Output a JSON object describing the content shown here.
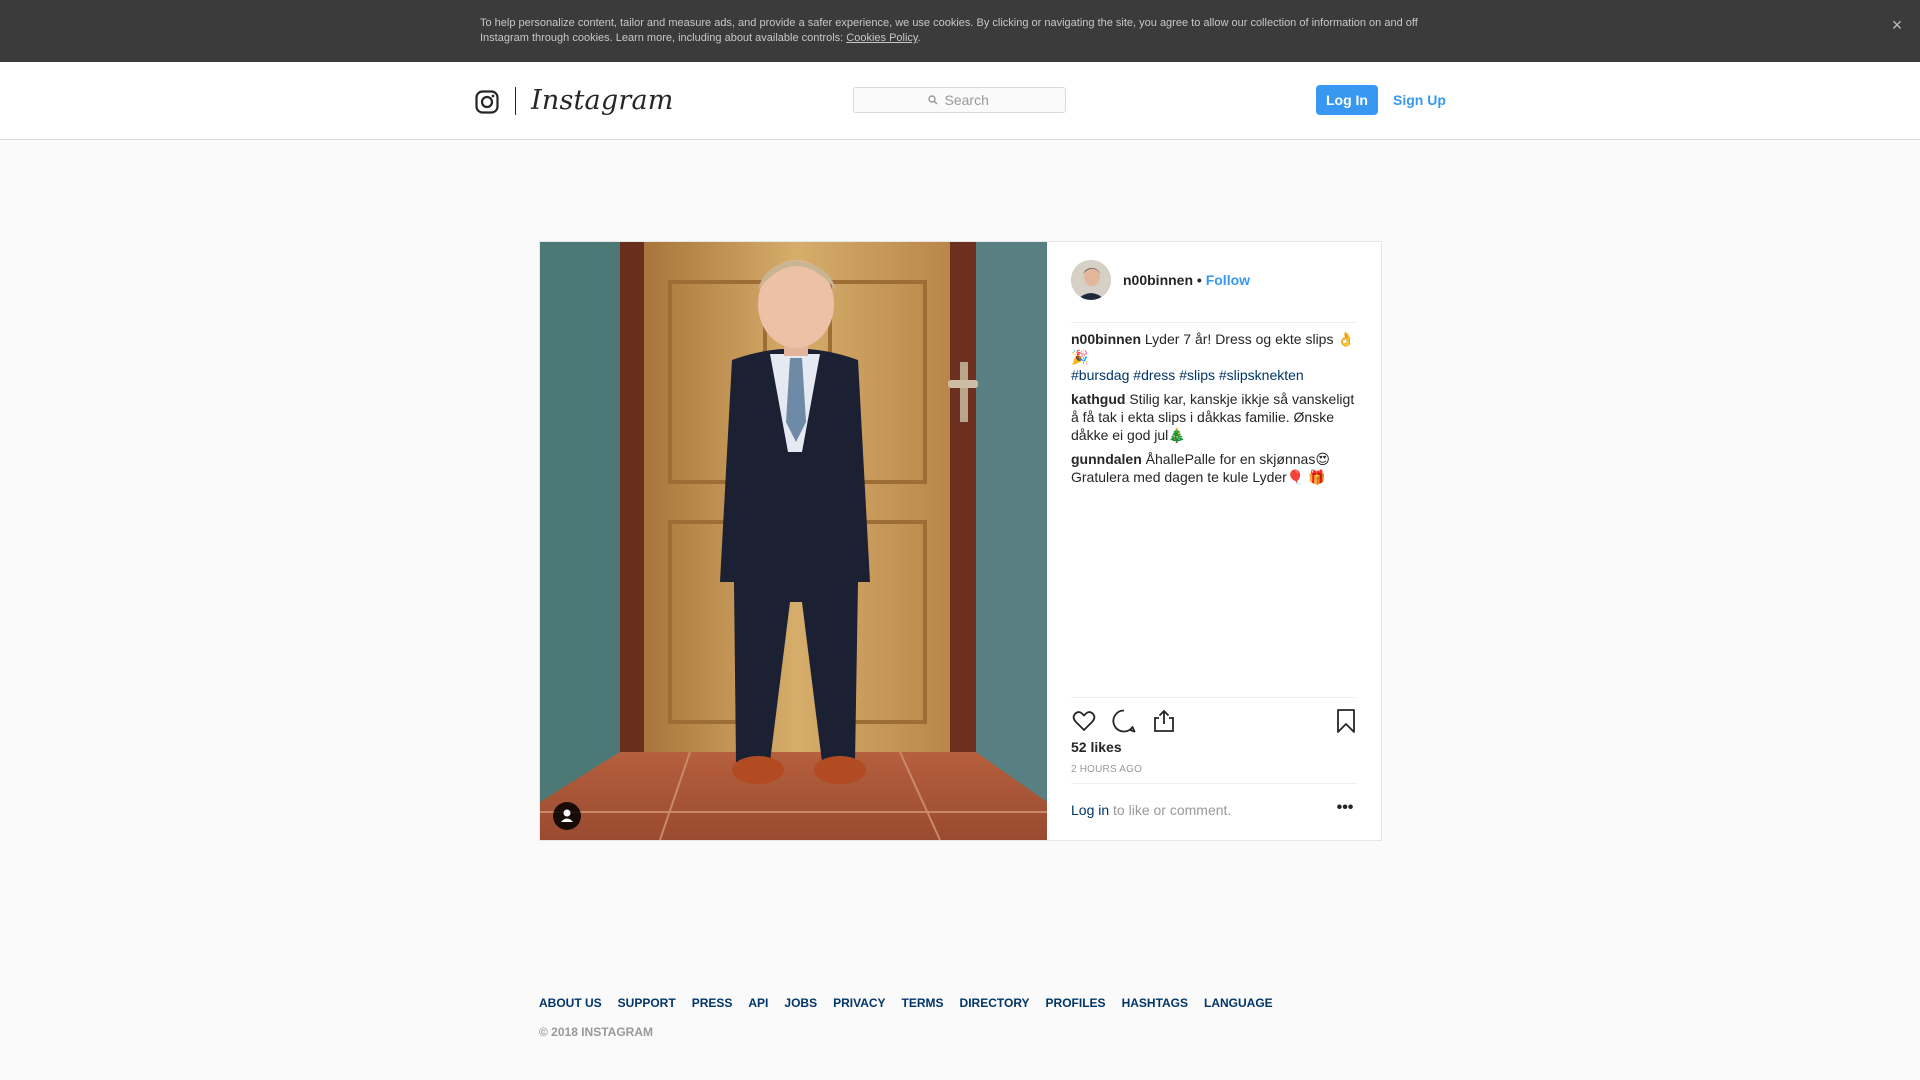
{
  "cookie_banner": {
    "text": "To help personalize content, tailor and measure ads, and provide a safer experience, we use cookies. By clicking or navigating the site, you agree to allow our collection of information on and off Instagram through cookies. Learn more, including about available controls: ",
    "policy_link": "Cookies Policy",
    "trailing": ".",
    "close_glyph": "×"
  },
  "header": {
    "wordmark": "Instagram",
    "search_placeholder": "Search",
    "login_label": "Log In",
    "signup_label": "Sign Up"
  },
  "post": {
    "author": "n00binnen",
    "separator": "•",
    "follow_label": "Follow",
    "caption": {
      "user": "n00binnen",
      "text": "Lyder 7 år! Dress og ekte slips 👌 🎉",
      "hashtags": [
        "#bursdag",
        "#dress",
        "#slips",
        "#slipsknekten"
      ]
    },
    "comments": [
      {
        "user": "kathgud",
        "text": "Stilig kar, kanskje ikkje så vanskeligt å få tak i ekta slips i dåkkas familie. Ønske dåkke ei god jul🎄"
      },
      {
        "user": "gunndalen",
        "text": "ÅhallePalle for en skjønnas😍 Gratulera med dagen te kule Lyder🎈 🎁"
      }
    ],
    "likes": "52 likes",
    "timestamp": "2 HOURS AGO",
    "login_link": "Log in",
    "login_rest": " to like or comment.",
    "more_glyph": "•••"
  },
  "footer": {
    "links": [
      "ABOUT US",
      "SUPPORT",
      "PRESS",
      "API",
      "JOBS",
      "PRIVACY",
      "TERMS",
      "DIRECTORY",
      "PROFILES",
      "HASHTAGS",
      "LANGUAGE"
    ],
    "copyright": "© 2018 INSTAGRAM"
  }
}
